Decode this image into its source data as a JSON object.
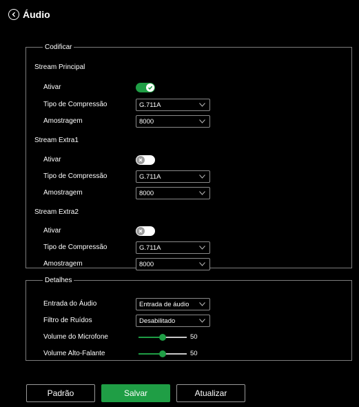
{
  "page": {
    "title": "Áudio"
  },
  "colors": {
    "accent": "#1f9e45",
    "background": "#000000",
    "border": "#7d7d7d"
  },
  "codificar": {
    "legend": "Codificar",
    "streams": [
      {
        "title": "Stream Principal",
        "ativar_label": "Ativar",
        "ativar_on": true,
        "compressao_label": "Tipo de Compressão",
        "compressao_value": "G.711A",
        "amostragem_label": "Amostragem",
        "amostragem_value": "8000"
      },
      {
        "title": "Stream Extra1",
        "ativar_label": "Ativar",
        "ativar_on": false,
        "compressao_label": "Tipo de Compressão",
        "compressao_value": "G.711A",
        "amostragem_label": "Amostragem",
        "amostragem_value": "8000"
      },
      {
        "title": "Stream Extra2",
        "ativar_label": "Ativar",
        "ativar_on": false,
        "compressao_label": "Tipo de Compressão",
        "compressao_value": "G.711A",
        "amostragem_label": "Amostragem",
        "amostragem_value": "8000"
      }
    ]
  },
  "detalhes": {
    "legend": "Detalhes",
    "entrada_label": "Entrada do Áudio",
    "entrada_value": "Entrada de áudio",
    "filtro_label": "Filtro de Ruídos",
    "filtro_value": "Desabilitado",
    "mic_label": "Volume do Microfone",
    "mic_value": "50",
    "mic_level_pct": 50,
    "speaker_label": "Volume Alto-Falante",
    "speaker_value": "50",
    "speaker_level_pct": 50
  },
  "footer": {
    "padrao": "Padrão",
    "salvar": "Salvar",
    "atualizar": "Atualizar"
  }
}
